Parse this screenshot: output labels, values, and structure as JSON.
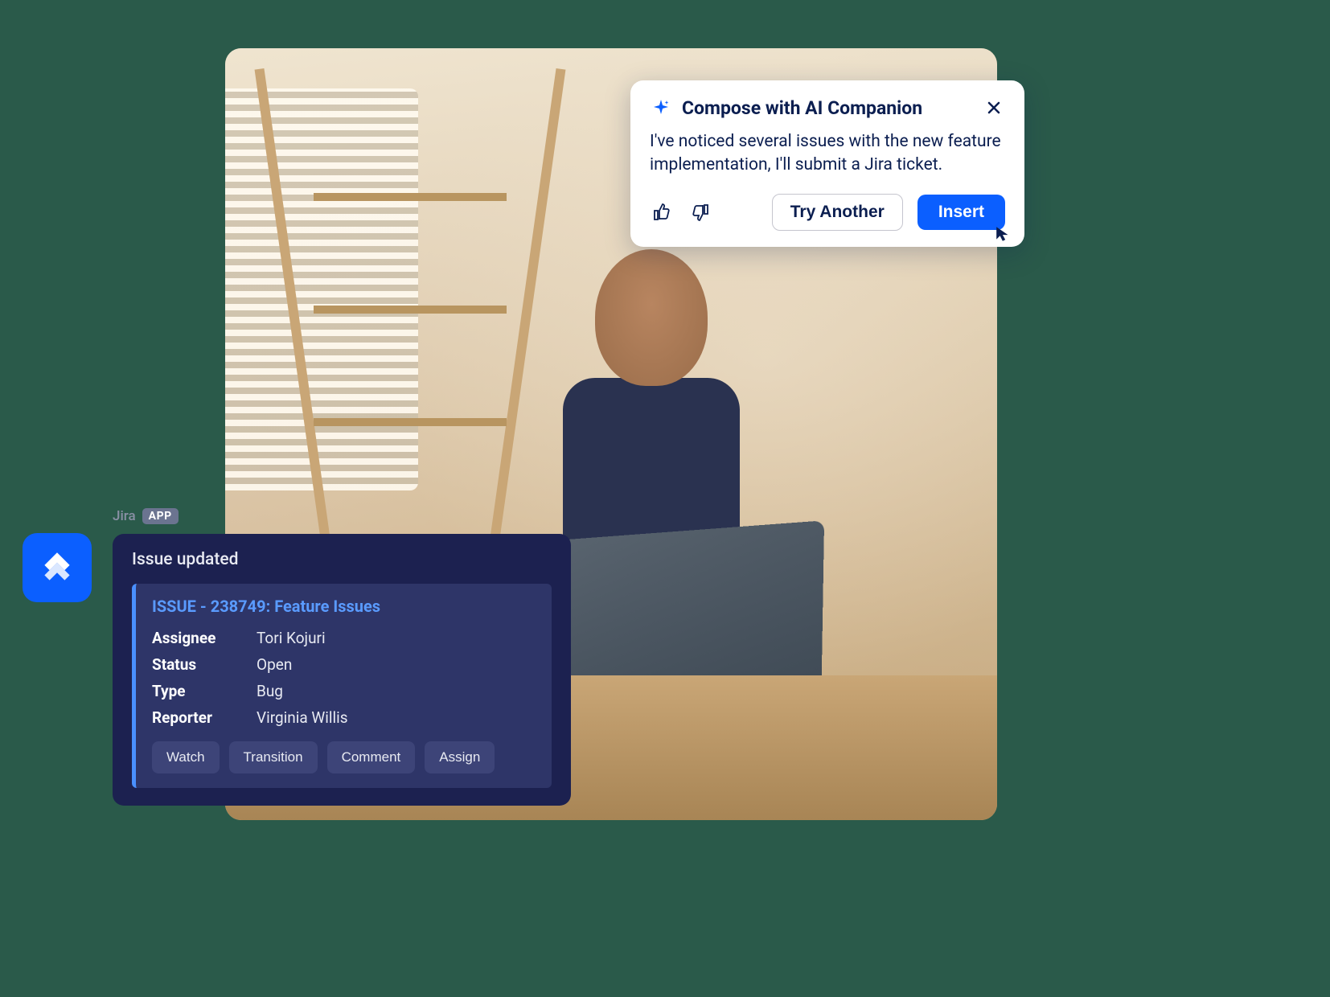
{
  "ai_popup": {
    "title": "Compose with AI Companion",
    "body": "I've noticed several issues with the new feature implementation, I'll submit a Jira ticket.",
    "try_another_label": "Try Another",
    "insert_label": "Insert"
  },
  "jira_label": {
    "name": "Jira",
    "badge": "APP"
  },
  "jira_card": {
    "header": "Issue updated",
    "issue_title": "ISSUE - 238749: Feature Issues",
    "fields": {
      "assignee_label": "Assignee",
      "assignee_value": "Tori Kojuri",
      "status_label": "Status",
      "status_value": "Open",
      "type_label": "Type",
      "type_value": "Bug",
      "reporter_label": "Reporter",
      "reporter_value": "Virginia Willis"
    },
    "buttons": {
      "watch": "Watch",
      "transition": "Transition",
      "comment": "Comment",
      "assign": "Assign"
    }
  }
}
